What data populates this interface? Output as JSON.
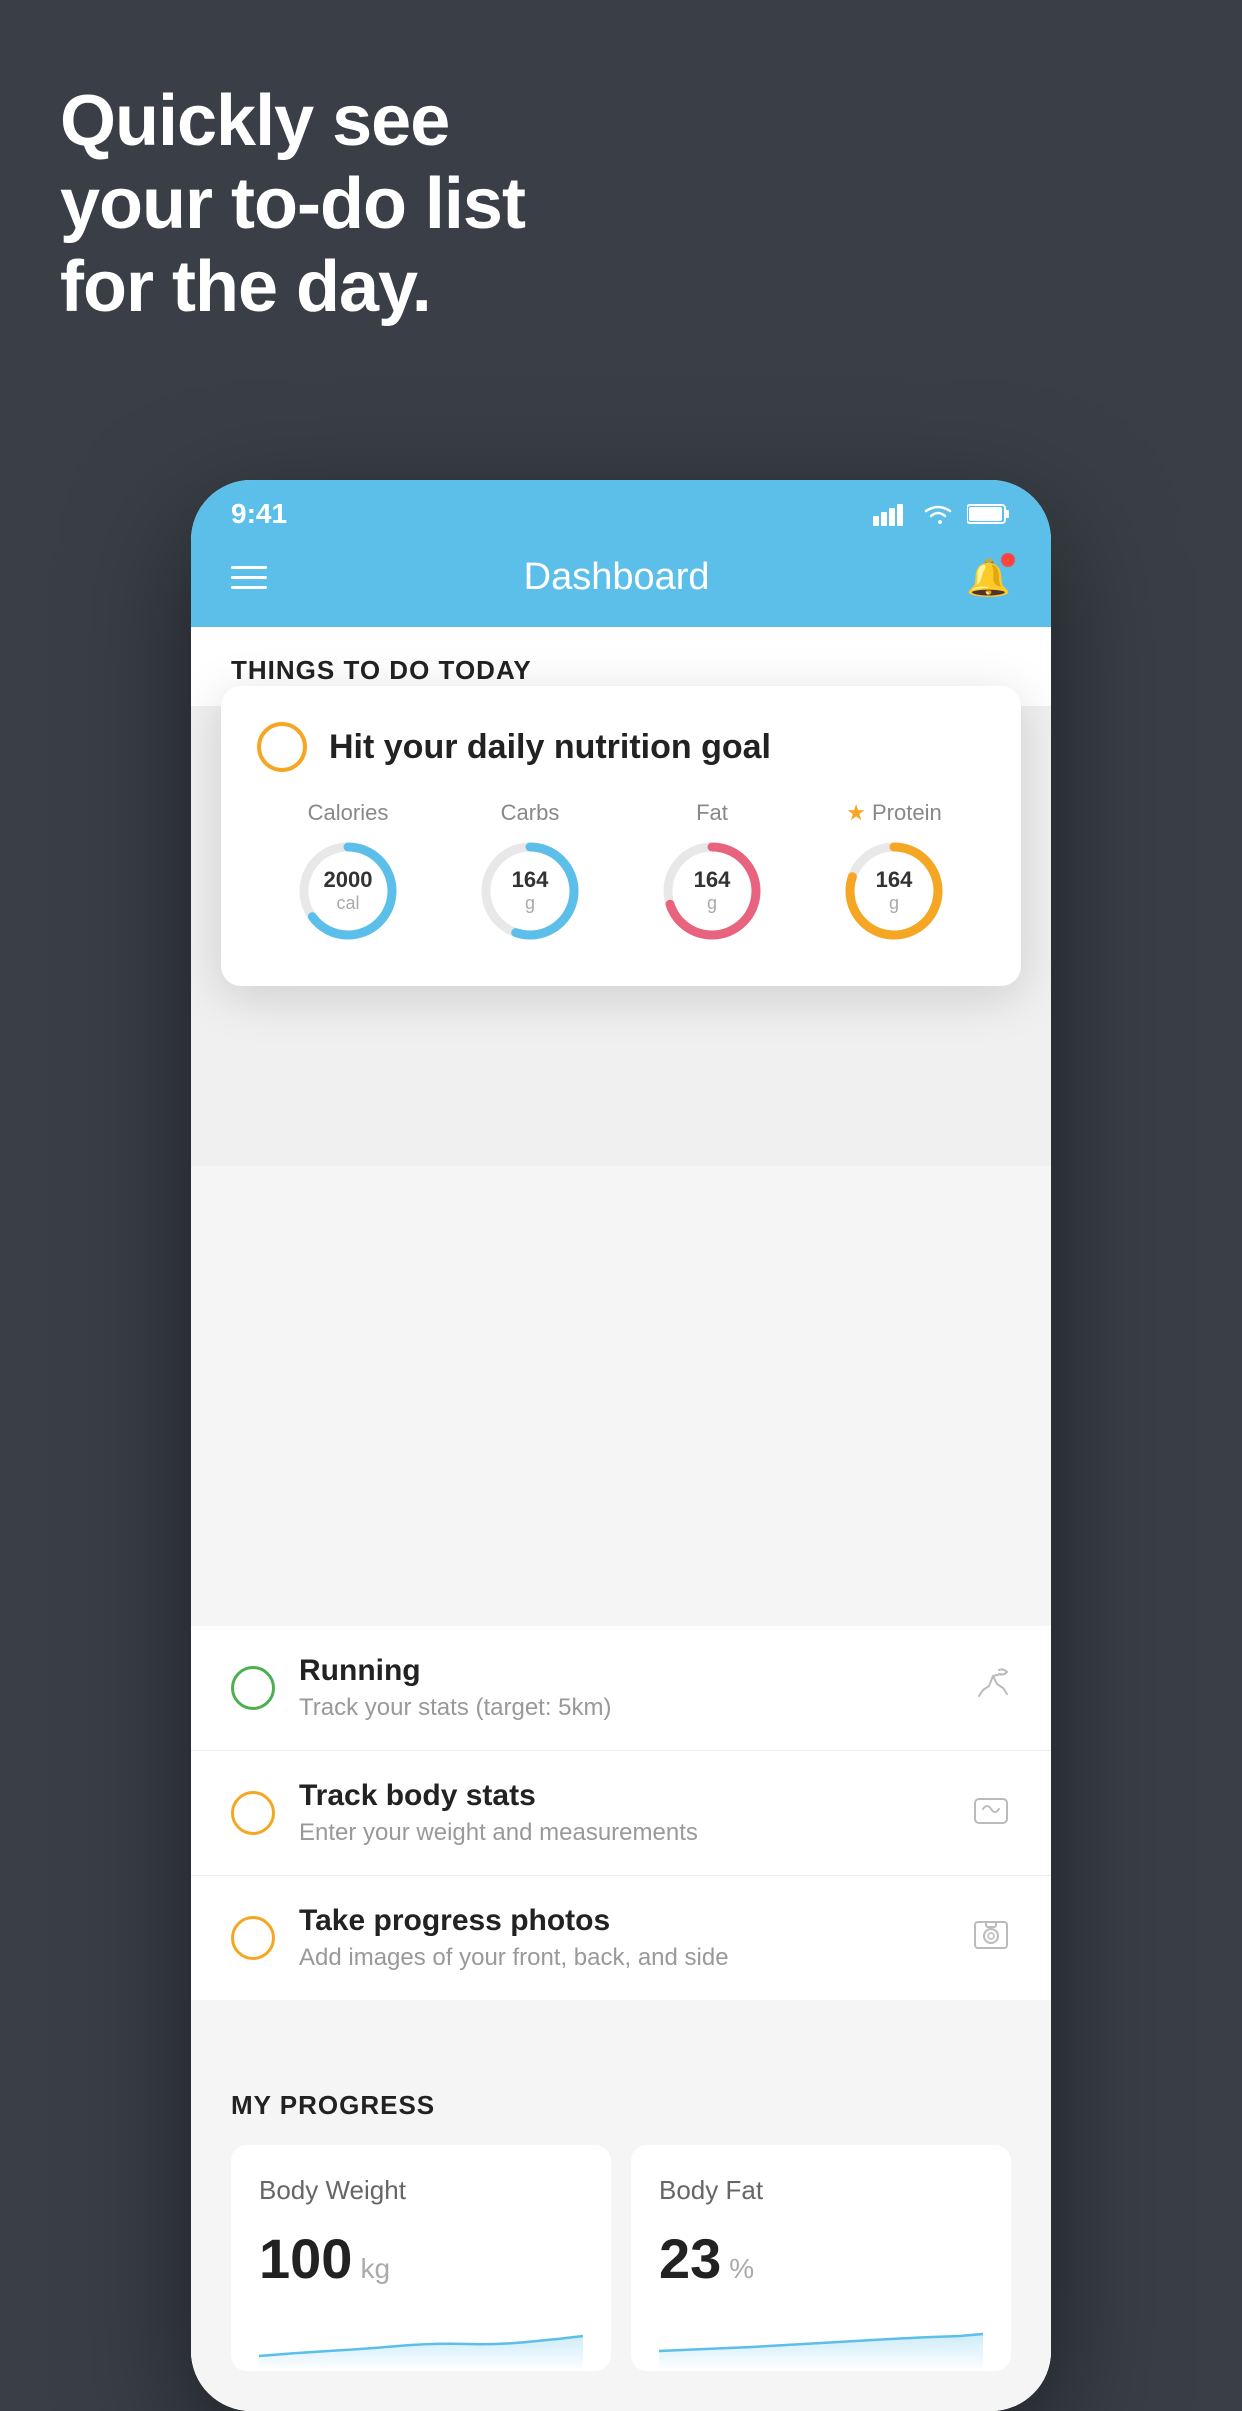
{
  "hero": {
    "line1": "Quickly see",
    "line2": "your to-do list",
    "line3": "for the day."
  },
  "status_bar": {
    "time": "9:41"
  },
  "nav": {
    "title": "Dashboard"
  },
  "things_section": {
    "label": "THINGS TO DO TODAY"
  },
  "nutrition_card": {
    "title": "Hit your daily nutrition goal",
    "items": [
      {
        "label": "Calories",
        "value": "2000",
        "unit": "cal",
        "color": "#5bbfea",
        "pct": 65,
        "starred": false
      },
      {
        "label": "Carbs",
        "value": "164",
        "unit": "g",
        "color": "#5bbfea",
        "pct": 55,
        "starred": false
      },
      {
        "label": "Fat",
        "value": "164",
        "unit": "g",
        "color": "#e8637e",
        "pct": 70,
        "starred": false
      },
      {
        "label": "Protein",
        "value": "164",
        "unit": "g",
        "color": "#f5a623",
        "pct": 80,
        "starred": true
      }
    ]
  },
  "todo_items": [
    {
      "title": "Running",
      "subtitle": "Track your stats (target: 5km)",
      "circle_color": "green",
      "icon": "👟"
    },
    {
      "title": "Track body stats",
      "subtitle": "Enter your weight and measurements",
      "circle_color": "yellow",
      "icon": "⚖️"
    },
    {
      "title": "Take progress photos",
      "subtitle": "Add images of your front, back, and side",
      "circle_color": "yellow-2",
      "icon": "🖼️"
    }
  ],
  "progress": {
    "label": "MY PROGRESS",
    "cards": [
      {
        "title": "Body Weight",
        "value": "100",
        "unit": "kg"
      },
      {
        "title": "Body Fat",
        "value": "23",
        "unit": "%"
      }
    ]
  }
}
